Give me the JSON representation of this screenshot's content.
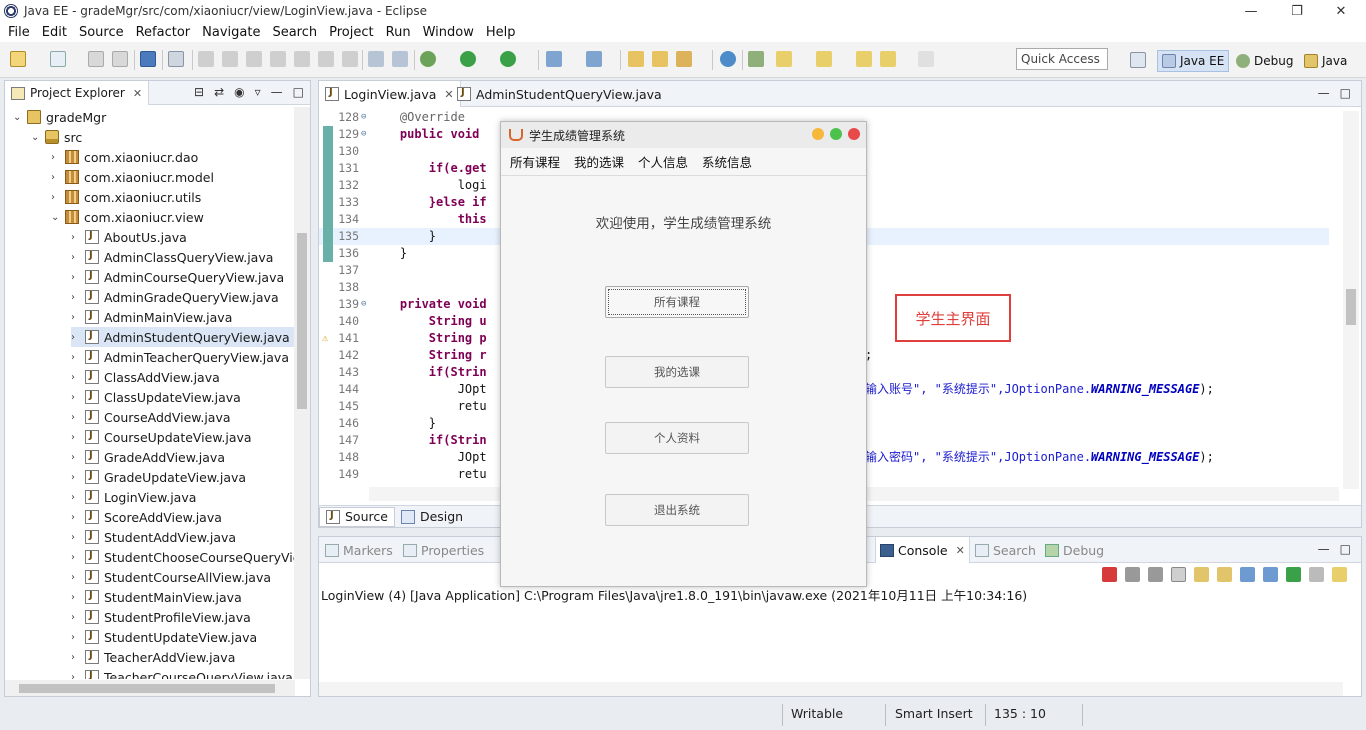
{
  "window": {
    "title": "Java EE - gradeMgr/src/com/xiaoniucr/view/LoginView.java - Eclipse"
  },
  "menubar": [
    "File",
    "Edit",
    "Source",
    "Refactor",
    "Navigate",
    "Search",
    "Project",
    "Run",
    "Window",
    "Help"
  ],
  "toolbar": {
    "quick_access": "Quick Access",
    "perspectives": [
      "Java EE",
      "Debug",
      "Java"
    ]
  },
  "project_explorer": {
    "title": "Project Explorer",
    "tree": [
      {
        "label": "gradeMgr",
        "type": "project",
        "level": 0,
        "expanded": true
      },
      {
        "label": "src",
        "type": "src",
        "level": 1,
        "expanded": true
      },
      {
        "label": "com.xiaoniucr.dao",
        "type": "pkg",
        "level": 2,
        "expanded": false
      },
      {
        "label": "com.xiaoniucr.model",
        "type": "pkg",
        "level": 2,
        "expanded": false
      },
      {
        "label": "com.xiaoniucr.utils",
        "type": "pkg",
        "level": 2,
        "expanded": false
      },
      {
        "label": "com.xiaoniucr.view",
        "type": "pkg",
        "level": 2,
        "expanded": true
      },
      {
        "label": "AboutUs.java",
        "type": "java",
        "level": 3
      },
      {
        "label": "AdminClassQueryView.java",
        "type": "java",
        "level": 3
      },
      {
        "label": "AdminCourseQueryView.java",
        "type": "java",
        "level": 3
      },
      {
        "label": "AdminGradeQueryView.java",
        "type": "java",
        "level": 3
      },
      {
        "label": "AdminMainView.java",
        "type": "java",
        "level": 3
      },
      {
        "label": "AdminStudentQueryView.java",
        "type": "java",
        "level": 3,
        "selected": true
      },
      {
        "label": "AdminTeacherQueryView.java",
        "type": "java",
        "level": 3
      },
      {
        "label": "ClassAddView.java",
        "type": "java",
        "level": 3
      },
      {
        "label": "ClassUpdateView.java",
        "type": "java",
        "level": 3
      },
      {
        "label": "CourseAddView.java",
        "type": "java",
        "level": 3
      },
      {
        "label": "CourseUpdateView.java",
        "type": "java",
        "level": 3
      },
      {
        "label": "GradeAddView.java",
        "type": "java",
        "level": 3
      },
      {
        "label": "GradeUpdateView.java",
        "type": "java",
        "level": 3
      },
      {
        "label": "LoginView.java",
        "type": "java",
        "level": 3
      },
      {
        "label": "ScoreAddView.java",
        "type": "java",
        "level": 3
      },
      {
        "label": "StudentAddView.java",
        "type": "java",
        "level": 3
      },
      {
        "label": "StudentChooseCourseQueryView",
        "type": "java",
        "level": 3
      },
      {
        "label": "StudentCourseAllView.java",
        "type": "java",
        "level": 3
      },
      {
        "label": "StudentMainView.java",
        "type": "java",
        "level": 3
      },
      {
        "label": "StudentProfileView.java",
        "type": "java",
        "level": 3
      },
      {
        "label": "StudentUpdateView.java",
        "type": "java",
        "level": 3
      },
      {
        "label": "TeacherAddView.java",
        "type": "java",
        "level": 3
      },
      {
        "label": "TeacherCourseQueryView.java",
        "type": "java",
        "level": 3
      }
    ]
  },
  "editor": {
    "tabs": [
      {
        "label": "LoginView.java",
        "active": true
      },
      {
        "label": "AdminStudentQueryView.java",
        "active": false
      }
    ],
    "lines": [
      {
        "n": "128",
        "code": "    @Override",
        "fold": "⊖"
      },
      {
        "n": "129",
        "code": "    public void ",
        "fold": "⊖",
        "mark": true
      },
      {
        "n": "130",
        "code": "",
        "mark": true
      },
      {
        "n": "131",
        "code": "        if(e.get",
        "mark": true
      },
      {
        "n": "132",
        "code": "            logi",
        "mark": true
      },
      {
        "n": "133",
        "code": "        }else if",
        "mark": true
      },
      {
        "n": "134",
        "code": "            this",
        "mark": true
      },
      {
        "n": "135",
        "code": "        }",
        "mark": true,
        "current": true
      },
      {
        "n": "136",
        "code": "    }",
        "mark": true
      },
      {
        "n": "137",
        "code": ""
      },
      {
        "n": "138",
        "code": ""
      },
      {
        "n": "139",
        "code": "    private void",
        "fold": "⊖"
      },
      {
        "n": "140",
        "code": "        String u"
      },
      {
        "n": "141",
        "code": "        String p",
        "warn": true
      },
      {
        "n": "142",
        "code": "        String r",
        "tail": ";"
      },
      {
        "n": "143",
        "code": "        if(Strin"
      },
      {
        "n": "144",
        "code": "            JOpt",
        "tail": "输入账号\", \"系统提示\",JOptionPane.",
        "tail_em": "WARNING_MESSAGE",
        "tail_end": ");"
      },
      {
        "n": "145",
        "code": "            retu"
      },
      {
        "n": "146",
        "code": "        }"
      },
      {
        "n": "147",
        "code": "        if(Strin"
      },
      {
        "n": "148",
        "code": "            JOpt",
        "tail": "输入密码\", \"系统提示\",JOptionPane.",
        "tail_em": "WARNING_MESSAGE",
        "tail_end": ");"
      },
      {
        "n": "149",
        "code": "            retu"
      }
    ],
    "bottom_tabs": [
      "Source",
      "Design"
    ],
    "annotation": "学生主界面"
  },
  "console": {
    "tabs": [
      "Markers",
      "Properties",
      "Console",
      "Search",
      "Debug"
    ],
    "active": "Console",
    "line": "LoginView (4) [Java Application] C:\\Program Files\\Java\\jre1.8.0_191\\bin\\javaw.exe (2021年10月11日 上午10:34:16)"
  },
  "statusbar": {
    "writable": "Writable",
    "insert_mode": "Smart Insert",
    "position": "135 : 10"
  },
  "dialog": {
    "title": "学生成绩管理系统",
    "menus": [
      "所有课程",
      "我的选课",
      "个人信息",
      "系统信息"
    ],
    "welcome": "欢迎使用，学生成绩管理系统",
    "buttons": [
      "所有课程",
      "我的选课",
      "个人资料",
      "退出系统"
    ]
  }
}
